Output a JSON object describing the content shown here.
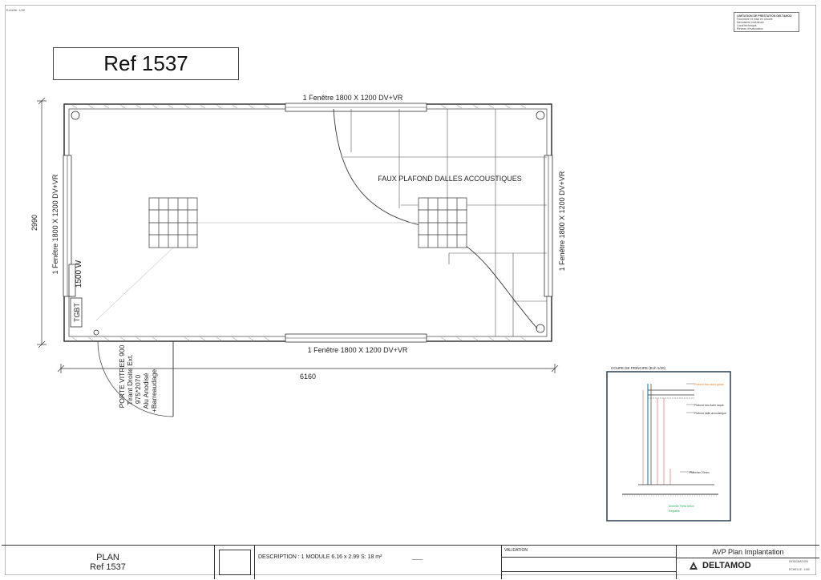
{
  "sheet": {
    "scale_note": "Echelle: 1/50",
    "ref_title": "Ref 1537",
    "legend_lines": [
      "LIMITATION DE PRESTATION DELTAMOD",
      "Fourniture et mise en oeuvre",
      "Menuiserie exterieure",
      "Local technique",
      "Reseau d'evacuation"
    ]
  },
  "plan": {
    "window_top": "1 Fenêtre 1800 X 1200 DV+VR",
    "window_bottom": "1 Fenêtre 1800 X 1200 DV+VR",
    "window_left": "1 Fenêtre 1800 X 1200 DV+VR",
    "window_right": "1 Fenêtre 1800 X 1200 DV+VR",
    "dim_length": "6160",
    "dim_width": "2990",
    "ceiling_label": "FAUX PLAFOND DALLES ACCOUSTIQUES",
    "heater_label": "1500 W",
    "panel_label": "TGBT",
    "door_lines": [
      "PORTE VITREE 900",
      "Tirant Droite Ext.",
      "975*2070",
      "Alu Anodisé",
      "+Barreaudage"
    ]
  },
  "section": {
    "title": "COUPE DE PRINCIPE (Ech 1/20)",
    "labels": [
      "Plafond bac acier galva",
      "Plafond bac Acier laqué",
      "Plafond dalle accoustique",
      "Plancher 20mm",
      "Semelle Préfa béton",
      "Réglable"
    ]
  },
  "titleblock": {
    "plan_label": "PLAN",
    "plan_ref": "Ref 1537",
    "description": "DESCRIPTION : 1 MODULE 6.16 x 2.99   S: 18 m²",
    "dash": "____",
    "validation": "VALIDATION",
    "avp_title": "AVP Plan Implantation",
    "brand": "DELTAMOD",
    "date_label": "DESIGNATION",
    "scale_label": "ECHELLE : 1/50"
  },
  "colors": {
    "line": "#333333",
    "accent_red": "#c0392b",
    "accent_orange": "#e67e22",
    "accent_green": "#27ae60",
    "accent_blue": "#2e86c1"
  }
}
